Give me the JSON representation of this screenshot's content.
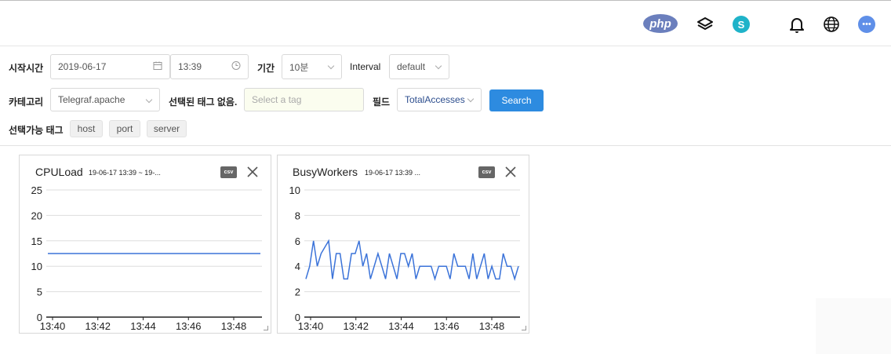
{
  "header": {
    "icons": [
      "php-icon",
      "layers-icon",
      "s-icon",
      "bell-icon",
      "globe-icon",
      "chat-icon"
    ],
    "php_label": "php",
    "s_label": "S"
  },
  "filters": {
    "start_time_label": "시작시간",
    "date_value": "2019-06-17",
    "time_value": "13:39",
    "period_label": "기간",
    "period_value": "10분",
    "interval_label": "Interval",
    "interval_value": "default",
    "category_label": "카테고리",
    "category_value": "Telegraf.apache",
    "selected_tags_label": "선택된 태그 없음.",
    "tag_placeholder": "Select a tag",
    "field_label": "필드",
    "field_value": "TotalAccesses",
    "search_label": "Search",
    "available_tags_label": "선택가능 태그",
    "available_tags": [
      "host",
      "port",
      "server"
    ]
  },
  "panels": [
    {
      "title": "CPULoad",
      "range": "19-06-17 13:39 ~ 19-...",
      "csv_label": "csv"
    },
    {
      "title": "BusyWorkers",
      "range": "19-06-17 13:39 ...",
      "csv_label": "csv"
    }
  ],
  "chart_data": [
    {
      "type": "line",
      "title": "CPULoad",
      "x_ticks": [
        "13:40",
        "13:42",
        "13:44",
        "13:46",
        "13:48"
      ],
      "ylim": [
        0,
        25
      ],
      "y_ticks": [
        0,
        5,
        10,
        15,
        20,
        25
      ],
      "grid": true,
      "color": "#3b73d9",
      "series": [
        {
          "values": [
            12.5,
            12.5,
            12.5,
            12.5,
            12.5,
            12.5,
            12.5,
            12.5,
            12.5,
            12.5,
            12.5,
            12.5,
            12.5,
            12.5,
            12.5,
            12.5,
            12.5,
            12.5,
            12.5,
            12.5,
            12.5,
            12.5,
            12.5,
            12.5,
            12.5,
            12.5,
            12.5,
            12.5,
            12.5,
            12.5,
            12.5,
            12.5,
            12.5,
            12.5,
            12.5,
            12.5,
            12.5,
            12.5,
            12.5,
            12.5,
            12.5,
            12.5,
            12.5,
            12.5,
            12.5,
            12.5
          ]
        }
      ]
    },
    {
      "type": "line",
      "title": "BusyWorkers",
      "x_ticks": [
        "13:40",
        "13:42",
        "13:44",
        "13:46",
        "13:48"
      ],
      "ylim": [
        0,
        10
      ],
      "y_ticks": [
        0,
        2,
        4,
        6,
        8,
        10
      ],
      "grid": true,
      "color": "#3b73d9",
      "series": [
        {
          "values": [
            3,
            4,
            6,
            4,
            5,
            5.5,
            6,
            3,
            5,
            5,
            3,
            3,
            5,
            5,
            6,
            4,
            5,
            3,
            4,
            5,
            4,
            3,
            5,
            4,
            3,
            5,
            5,
            4,
            5,
            3,
            4,
            4,
            4,
            4,
            3,
            4,
            4,
            4,
            3,
            5,
            4,
            4,
            4,
            3,
            5,
            3,
            4,
            5,
            3,
            4,
            3,
            3,
            5,
            4,
            4,
            3,
            4
          ]
        }
      ]
    }
  ]
}
